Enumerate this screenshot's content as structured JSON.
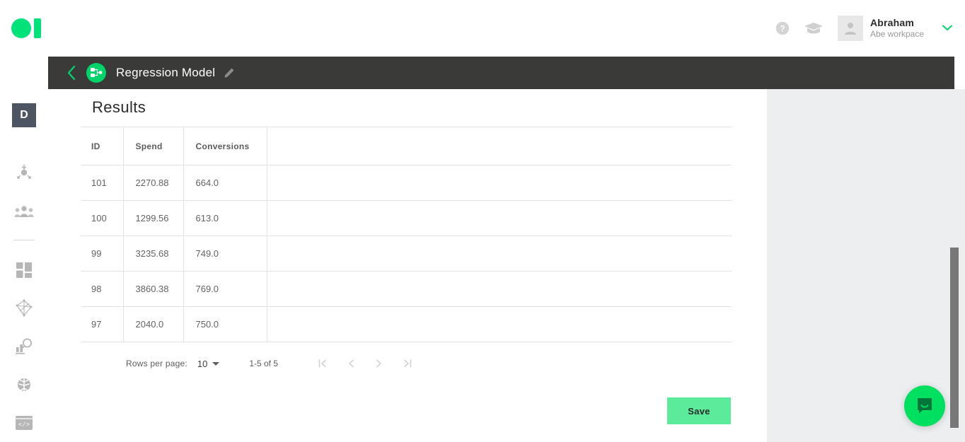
{
  "topbar": {
    "logo_name": "logo-mark",
    "help_icon": "help-circle-icon",
    "education_icon": "graduation-cap-icon",
    "user": {
      "name": "Abraham",
      "workspace": "Abe workpace",
      "avatar_icon": "person-avatar-icon",
      "chevron_icon": "chevron-down-icon"
    }
  },
  "rail": {
    "badge": "D",
    "items": [
      {
        "icon": "data-source-import-icon",
        "label": "Data Sources"
      },
      {
        "icon": "audience-people-icon",
        "label": "Audiences"
      },
      {
        "icon": "dashboard-grid-icon",
        "label": "Dashboards"
      },
      {
        "icon": "network-graph-icon",
        "label": "Graph"
      },
      {
        "icon": "chart-insights-search-icon",
        "label": "Insights"
      },
      {
        "icon": "brain-ai-icon",
        "label": "AI Models"
      },
      {
        "icon": "code-window-icon",
        "label": "Code"
      }
    ]
  },
  "titlebar": {
    "back_icon": "chevron-left-icon",
    "flow_icon": "flow-diagram-icon",
    "title": "Regression Model",
    "edit_icon": "pencil-edit-icon"
  },
  "main": {
    "heading": "Results",
    "table": {
      "columns": [
        "ID",
        "Spend",
        "Conversions",
        ""
      ],
      "rows": [
        [
          "101",
          "2270.88",
          "664.0",
          ""
        ],
        [
          "100",
          "1299.56",
          "613.0",
          ""
        ],
        [
          "99",
          "3235.68",
          "749.0",
          ""
        ],
        [
          "98",
          "3860.38",
          "769.0",
          ""
        ],
        [
          "97",
          "2040.0",
          "750.0",
          ""
        ]
      ]
    },
    "pagination": {
      "rows_per_page_label": "Rows per page:",
      "rows_per_page_value": "10",
      "range": "1-5 of 5",
      "first_icon": "first-page-icon",
      "prev_icon": "previous-page-icon",
      "next_icon": "next-page-icon",
      "last_icon": "last-page-icon"
    },
    "save_label": "Save"
  },
  "rightpanel": {
    "chat_icon": "intercom-chat-icon",
    "scrollbar": "vertical-scrollbar"
  },
  "colors": {
    "brand_green": "#00e27a",
    "titlebar_dark": "#3a3a39",
    "save_green": "#5ceb9b",
    "panel_gray": "#eceef0",
    "rail_badge": "#4d5563"
  }
}
